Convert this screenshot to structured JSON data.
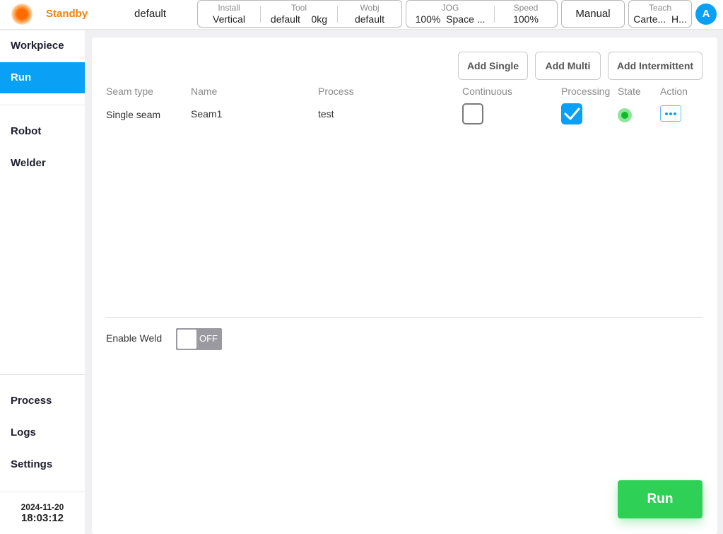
{
  "topbar": {
    "status": "Standby",
    "program": "default",
    "install": {
      "label": "Install",
      "value": "Vertical"
    },
    "tool": {
      "label": "Tool",
      "name": "default",
      "load": "0kg"
    },
    "wobj": {
      "label": "Wobj",
      "value": "default"
    },
    "jog": {
      "label": "JOG",
      "percent": "100%",
      "mode": "Space ..."
    },
    "speed": {
      "label": "Speed",
      "value": "100%"
    },
    "mode_button": "Manual",
    "teach": {
      "label": "Teach",
      "frame": "Carte...",
      "extra": "H..."
    },
    "avatar": "A"
  },
  "sidebar": {
    "items": [
      {
        "label": "Workpiece",
        "active": false
      },
      {
        "label": "Run",
        "active": true
      },
      {
        "label": "Robot",
        "active": false
      },
      {
        "label": "Welder",
        "active": false
      },
      {
        "label": "Process",
        "active": false
      },
      {
        "label": "Logs",
        "active": false
      },
      {
        "label": "Settings",
        "active": false
      }
    ],
    "date": "2024-11-20",
    "time": "18:03:12"
  },
  "main": {
    "buttons": {
      "add_single": "Add Single",
      "add_multi": "Add Multi",
      "add_intermittent": "Add Intermittent"
    },
    "columns": [
      "Seam type",
      "Name",
      "Process",
      "Continuous",
      "Processing",
      "State",
      "Action"
    ],
    "rows": [
      {
        "seam_type": "Single seam",
        "name": "Seam1",
        "process": "test",
        "continuous": false,
        "processing": true,
        "state": "ok"
      }
    ],
    "enable_weld": {
      "label": "Enable Weld",
      "state": "OFF"
    },
    "run_button": "Run"
  },
  "colors": {
    "accent": "#0aa0f5",
    "status": "#f0830e",
    "run": "#2fd056",
    "state_ok": "#11b827"
  }
}
